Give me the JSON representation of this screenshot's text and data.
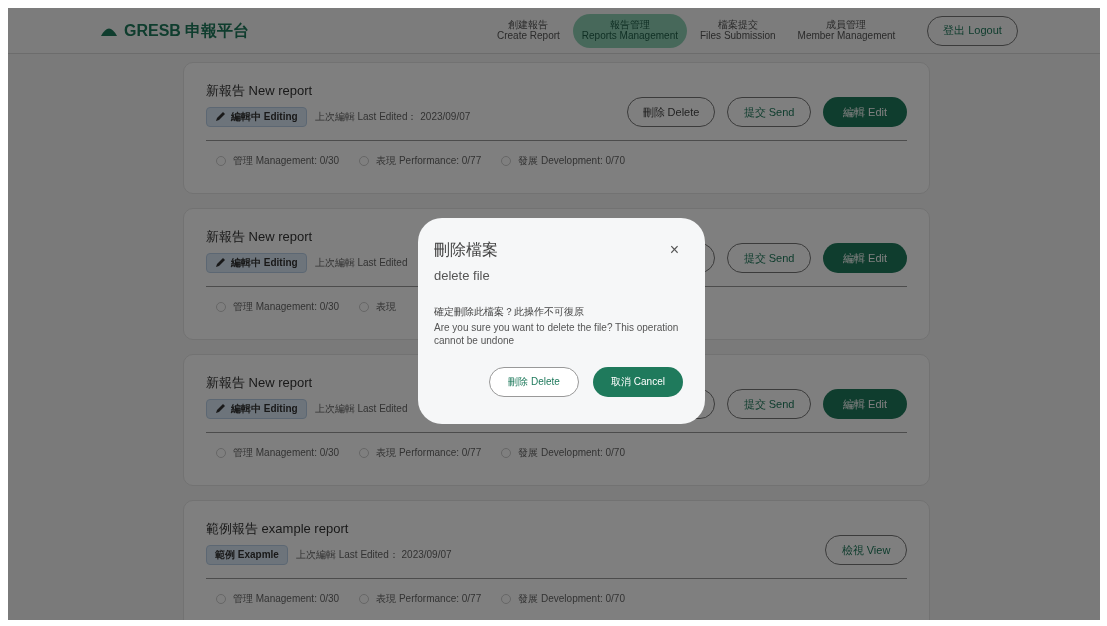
{
  "header": {
    "logo": "GRESB 申報平台",
    "nav": [
      {
        "zh": "創建報告",
        "en": "Create Report",
        "selected": false
      },
      {
        "zh": "報告管理",
        "en": "Reports Management",
        "selected": true
      },
      {
        "zh": "檔案提交",
        "en": "Files Submission",
        "selected": false
      },
      {
        "zh": "成員管理",
        "en": "Member Management",
        "selected": false
      }
    ],
    "logout": "登出 Logout"
  },
  "cards": [
    {
      "title": "新報告 New report",
      "badge": {
        "kind": "editing",
        "label": "編輯中 Editing"
      },
      "last_edited": "上次編輯 Last Edited： 2023/09/07",
      "buttons": [
        {
          "kind": "delete",
          "label": "刪除 Delete"
        },
        {
          "kind": "send",
          "label": "提交 Send"
        },
        {
          "kind": "edit",
          "label": "編輯 Edit"
        }
      ],
      "progress": [
        "管理 Management: 0/30",
        "表現 Performance: 0/77",
        "發展 Development: 0/70"
      ]
    },
    {
      "title": "新報告 New report",
      "badge": {
        "kind": "editing",
        "label": "編輯中 Editing"
      },
      "last_edited": "上次編輯 Last Edited",
      "buttons": [
        {
          "kind": "delete"
        },
        {
          "kind": "send",
          "label": "提交 Send"
        },
        {
          "kind": "edit",
          "label": "編輯 Edit"
        }
      ],
      "progress": [
        "管理 Management: 0/30",
        "表現"
      ]
    },
    {
      "title": "新報告 New report",
      "badge": {
        "kind": "editing",
        "label": "編輯中 Editing"
      },
      "last_edited": "上次編輯 Last Edited",
      "buttons": [
        {
          "kind": "delete"
        },
        {
          "kind": "send",
          "label": "提交 Send"
        },
        {
          "kind": "edit",
          "label": "編輯 Edit"
        }
      ],
      "progress": [
        "管理 Management: 0/30",
        "表現 Performance: 0/77",
        "發展 Development: 0/70"
      ]
    },
    {
      "title": "範例報告 example report",
      "badge": {
        "kind": "example",
        "label": "範例 Exapmle"
      },
      "last_edited": "上次編輯 Last Edited： 2023/09/07",
      "buttons": [
        {
          "kind": "view",
          "label": "檢視 View"
        }
      ],
      "progress": [
        "管理 Management: 0/30",
        "表現 Performance: 0/77",
        "發展 Development: 0/70"
      ]
    }
  ],
  "dialog": {
    "title": "刪除檔案",
    "subtitle": "delete file",
    "close": "×",
    "message_zh": "確定刪除此檔案？此操作不可復原",
    "message_en": "Are you sure you want to delete the file? This operation cannot be undone",
    "buttons": [
      {
        "kind": "delete",
        "label": "刪除 Delete"
      },
      {
        "kind": "cancel",
        "label": "取消 Cancel"
      }
    ]
  }
}
